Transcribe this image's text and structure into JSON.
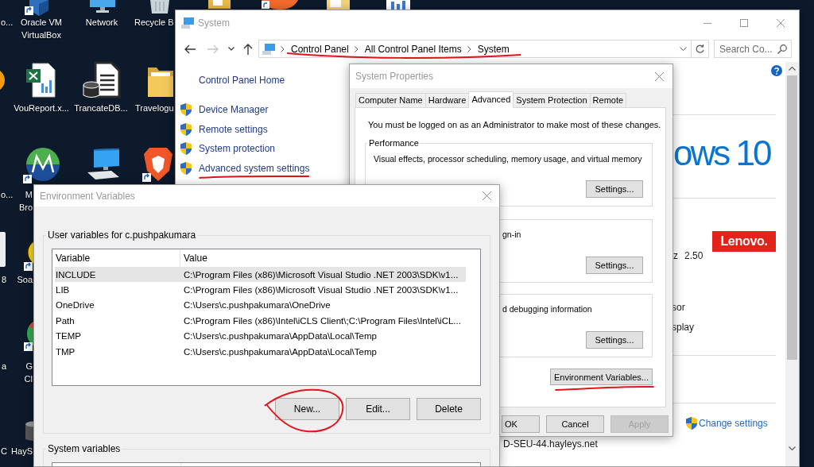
{
  "desktop": {
    "icons": [
      {
        "label": "o..."
      },
      {
        "label": "Oracle VM VirtualBox"
      },
      {
        "label": "Network"
      },
      {
        "label": "Recycle B"
      },
      {
        "label": "VouReport.x..."
      },
      {
        "label": "TrancateDB..."
      },
      {
        "label": "Travelogu"
      },
      {
        "label": "o..."
      },
      {
        "label": "M Bro"
      },
      {
        "label": "8"
      },
      {
        "label": "Soa"
      },
      {
        "label": "a"
      },
      {
        "label": "G Cl"
      },
      {
        "label": "C"
      },
      {
        "label": "HayS"
      }
    ]
  },
  "system_window": {
    "title": "System",
    "nav_buttons": [
      {
        "kind": "back",
        "disabled": false
      },
      {
        "kind": "forward",
        "disabled": true
      },
      {
        "kind": "recent",
        "disabled": false
      },
      {
        "kind": "up",
        "disabled": false
      }
    ],
    "address_bar": {
      "crumbs": [
        "Control Panel",
        "All Control Panel Items",
        "System"
      ],
      "underlined": true
    },
    "search": {
      "placeholder": "Search Co..."
    },
    "sidebar": {
      "home": "Control Panel Home",
      "links": [
        {
          "label": "Device Manager",
          "underlined": false
        },
        {
          "label": "Remote settings",
          "underlined": false
        },
        {
          "label": "System protection",
          "underlined": false
        },
        {
          "label": "Advanced system settings",
          "underlined": true
        }
      ]
    },
    "info": {
      "edition_logo": "ows 10",
      "maker_logo": "Lenovo.",
      "fragments": [
        "z",
        "2.50",
        "sor",
        "splay"
      ],
      "change_settings": "Change settings",
      "name_fragment": "D-SEU-44.hayleys.net"
    }
  },
  "system_properties": {
    "title": "System Properties",
    "tabs": [
      {
        "label": "Computer Name",
        "selected": false
      },
      {
        "label": "Hardware",
        "selected": false
      },
      {
        "label": "Advanced",
        "selected": true
      },
      {
        "label": "System Protection",
        "selected": false
      },
      {
        "label": "Remote",
        "selected": false
      }
    ],
    "notice": "You must be logged on as an Administrator to make most of these changes.",
    "groups": [
      {
        "title": "Performance",
        "text": "Visual effects, processor scheduling, memory usage, and virtual memory",
        "button": "Settings..."
      },
      {
        "text": "gn-in",
        "button": "Settings..."
      },
      {
        "text": "d debugging information",
        "button": "Settings..."
      }
    ],
    "env_button": {
      "label": "Environment Variables...",
      "underlined": true
    },
    "buttons": [
      {
        "label": "OK",
        "disabled": false
      },
      {
        "label": "Cancel",
        "disabled": false
      },
      {
        "label": "Apply",
        "disabled": true
      }
    ]
  },
  "env_dialog": {
    "title": "Environment Variables",
    "user_group": "User variables for c.pushpakumara",
    "columns": [
      "Variable",
      "Value"
    ],
    "rows": [
      {
        "variable": "INCLUDE",
        "value": "C:\\Program Files (x86)\\Microsoft Visual Studio .NET 2003\\SDK\\v1...",
        "selected": true
      },
      {
        "variable": "LIB",
        "value": "C:\\Program Files (x86)\\Microsoft Visual Studio .NET 2003\\SDK\\v1...",
        "selected": false
      },
      {
        "variable": "OneDrive",
        "value": "C:\\Users\\c.pushpakumara\\OneDrive",
        "selected": false
      },
      {
        "variable": "Path",
        "value": "C:\\Program Files (x86)\\Intel\\iCLS Client\\;C:\\Program Files\\Intel\\iCL...",
        "selected": false
      },
      {
        "variable": "TEMP",
        "value": "C:\\Users\\c.pushpakumara\\AppData\\Local\\Temp",
        "selected": false
      },
      {
        "variable": "TMP",
        "value": "C:\\Users\\c.pushpakumara\\AppData\\Local\\Temp",
        "selected": false
      }
    ],
    "buttons": [
      {
        "label": "New...",
        "circled": true
      },
      {
        "label": "Edit...",
        "circled": false
      },
      {
        "label": "Delete",
        "circled": false
      }
    ],
    "system_group": "System variables"
  }
}
